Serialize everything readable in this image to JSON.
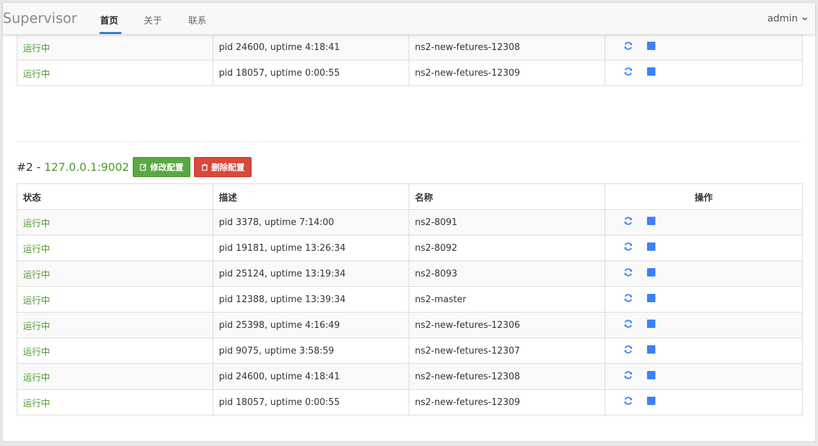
{
  "nav": {
    "brand": "Supervisor",
    "items": [
      {
        "label": "首页",
        "active": true
      },
      {
        "label": "关于",
        "active": false
      },
      {
        "label": "联系",
        "active": false
      }
    ],
    "user": "admin"
  },
  "server1": {
    "rows": [
      {
        "status": "运行中",
        "desc": "pid 24600, uptime 4:18:41",
        "name": "ns2-new-fetures-12308"
      },
      {
        "status": "运行中",
        "desc": "pid 18057, uptime 0:00:55",
        "name": "ns2-new-fetures-12309"
      }
    ]
  },
  "server2": {
    "title_prefix": "#2 - ",
    "address": "127.0.0.1:9002",
    "edit_label": "修改配置",
    "delete_label": "删除配置",
    "headers": {
      "status": "状态",
      "desc": "描述",
      "name": "名称",
      "ops": "操作"
    },
    "rows": [
      {
        "status": "运行中",
        "desc": "pid 3378, uptime 7:14:00",
        "name": "ns2-8091"
      },
      {
        "status": "运行中",
        "desc": "pid 19181, uptime 13:26:34",
        "name": "ns2-8092"
      },
      {
        "status": "运行中",
        "desc": "pid 25124, uptime 13:19:34",
        "name": "ns2-8093"
      },
      {
        "status": "运行中",
        "desc": "pid 12388, uptime 13:39:34",
        "name": "ns2-master"
      },
      {
        "status": "运行中",
        "desc": "pid 25398, uptime 4:16:49",
        "name": "ns2-new-fetures-12306"
      },
      {
        "status": "运行中",
        "desc": "pid 9075, uptime 3:58:59",
        "name": "ns2-new-fetures-12307"
      },
      {
        "status": "运行中",
        "desc": "pid 24600, uptime 4:18:41",
        "name": "ns2-new-fetures-12308"
      },
      {
        "status": "运行中",
        "desc": "pid 18057, uptime 0:00:55",
        "name": "ns2-new-fetures-12309"
      }
    ]
  },
  "icons": {
    "restart": "refresh-icon",
    "stop": "stop-icon"
  },
  "colors": {
    "running": "#4a9a2e",
    "accent": "#3b82f6",
    "edit": "#5aa843",
    "delete": "#d9483b"
  }
}
